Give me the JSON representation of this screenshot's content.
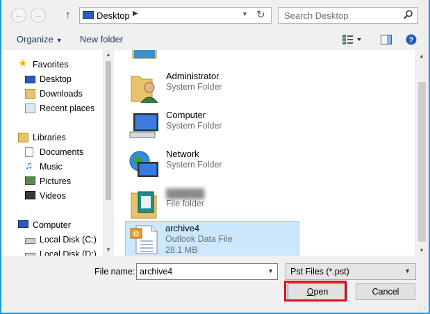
{
  "address_bar": {
    "back_icon": "back-arrow-icon",
    "forward_icon": "forward-arrow-icon",
    "up_icon": "up-arrow-icon",
    "location": "Desktop",
    "search_placeholder": "Search Desktop"
  },
  "toolbar": {
    "organize_label": "Organize",
    "new_folder_label": "New folder"
  },
  "nav": {
    "favorites": {
      "label": "Favorites",
      "items": [
        "Desktop",
        "Downloads",
        "Recent places"
      ]
    },
    "libraries": {
      "label": "Libraries",
      "items": [
        "Documents",
        "Music",
        "Pictures",
        "Videos"
      ]
    },
    "computer": {
      "label": "Computer",
      "items": [
        "Local Disk (C:)",
        "Local Disk (D:)"
      ]
    }
  },
  "files": [
    {
      "name": "",
      "type": "System Folder",
      "icon": "folder-icon"
    },
    {
      "name": "Administrator",
      "type": "System Folder",
      "icon": "user-folder-icon"
    },
    {
      "name": "Computer",
      "type": "System Folder",
      "icon": "computer-icon"
    },
    {
      "name": "Network",
      "type": "System Folder",
      "icon": "network-icon"
    },
    {
      "name": "",
      "type": "File folder",
      "icon": "folder-icon",
      "blurred": true
    },
    {
      "name": "archive4",
      "type": "Outlook Data File",
      "size": "28.1 MB",
      "icon": "outlook-file-icon",
      "selected": true
    }
  ],
  "bottom": {
    "file_name_label": "File name:",
    "file_name_value": "archive4",
    "file_type_value": "Pst Files (*.pst)",
    "open_label_underlined": "O",
    "open_label_rest": "pen",
    "cancel_label": "Cancel"
  },
  "colors": {
    "accent": "#1c9bd8",
    "selection": "#cce8ff",
    "highlight": "#e0101b"
  }
}
